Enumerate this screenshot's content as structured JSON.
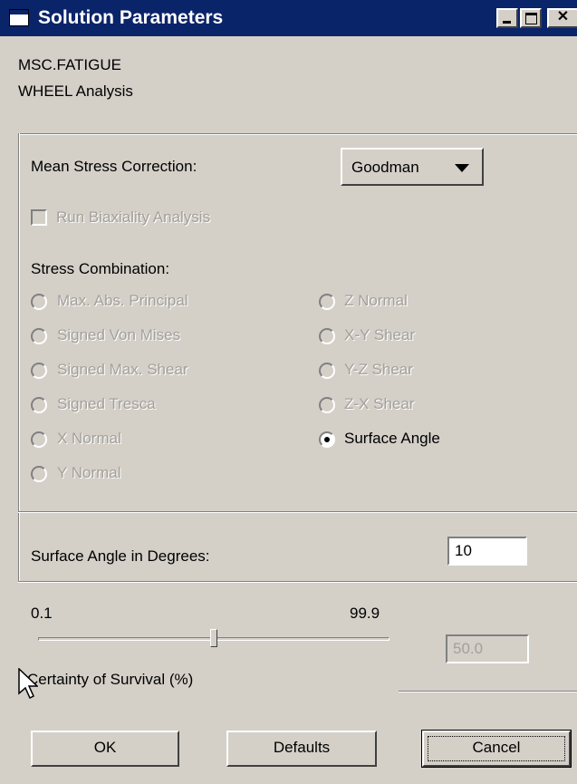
{
  "window": {
    "title": "Solution Parameters",
    "controls": [
      "minimize",
      "maximize",
      "close"
    ],
    "close_glyph": "✕"
  },
  "header": {
    "line1": "MSC.FATIGUE",
    "line2": "WHEEL Analysis"
  },
  "mean_stress": {
    "label": "Mean Stress Correction:",
    "selected": "Goodman"
  },
  "biaxiality": {
    "label": "Run Biaxiality Analysis",
    "checked": false,
    "enabled": false
  },
  "stress_combination": {
    "label": "Stress Combination:",
    "left_options": [
      {
        "label": "Max. Abs. Principal",
        "enabled": false,
        "selected": false
      },
      {
        "label": "Signed Von Mises",
        "enabled": false,
        "selected": false
      },
      {
        "label": "Signed Max. Shear",
        "enabled": false,
        "selected": false
      },
      {
        "label": "Signed Tresca",
        "enabled": false,
        "selected": false
      },
      {
        "label": "X Normal",
        "enabled": false,
        "selected": false
      },
      {
        "label": "Y Normal",
        "enabled": false,
        "selected": false
      }
    ],
    "right_options": [
      {
        "label": "Z Normal",
        "enabled": false,
        "selected": false
      },
      {
        "label": "X-Y Shear",
        "enabled": false,
        "selected": false
      },
      {
        "label": "Y-Z Shear",
        "enabled": false,
        "selected": false
      },
      {
        "label": "Z-X Shear",
        "enabled": false,
        "selected": false
      },
      {
        "label": "Surface Angle",
        "enabled": true,
        "selected": true
      }
    ]
  },
  "surface_angle": {
    "label": "Surface Angle in Degrees:",
    "value": "10"
  },
  "certainty": {
    "min_label": "0.1",
    "max_label": "99.9",
    "value": "50.0",
    "label": "Certainty of Survival (%)"
  },
  "buttons": {
    "ok": "OK",
    "defaults": "Defaults",
    "cancel": "Cancel"
  },
  "colors": {
    "titlebar": "#0a246a",
    "face": "#d4d0c8"
  }
}
